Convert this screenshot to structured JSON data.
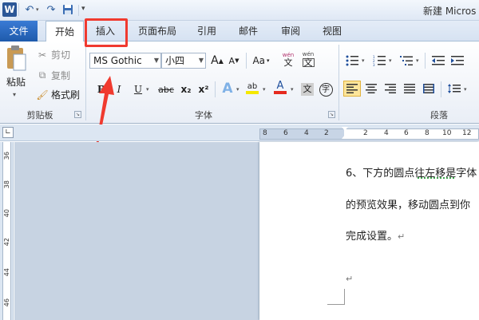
{
  "window": {
    "title": "新建 Micros"
  },
  "tabs": [
    "文件",
    "开始",
    "插入",
    "页面布局",
    "引用",
    "邮件",
    "审阅",
    "视图"
  ],
  "clipboard": {
    "paste": "粘贴",
    "cut": "剪切",
    "copy": "复制",
    "format_painter": "格式刷",
    "group_label": "剪贴板"
  },
  "font": {
    "name": "MS Gothic",
    "size": "小四",
    "group_label": "字体",
    "grow": "A",
    "shrink": "A",
    "change_case": "Aa",
    "wen": "wén",
    "wen2": "文",
    "bold": "B",
    "italic": "I",
    "underline": "U",
    "strike": "abc",
    "subscript": "x₂",
    "superscript": "x²",
    "text_effect": "A",
    "highlight": "ab",
    "font_color": "A",
    "enclose": "字"
  },
  "paragraph": {
    "group_label": "段落"
  },
  "ruler": {
    "numbers": [
      "8",
      "6",
      "4",
      "2",
      "",
      "2",
      "4",
      "6",
      "8",
      "10",
      "12"
    ],
    "vnumbers": [
      "36",
      "38",
      "40",
      "42",
      "44",
      "46"
    ]
  },
  "document": {
    "lines": [
      "6、下方的圆点往左移是字体",
      "的预览效果，移动圆点到你",
      "完成设置。"
    ],
    "para_mark": "↵"
  },
  "colors": {
    "annotation_red": "#f03a2f",
    "file_tab": "#2b66bf",
    "highlight": "#f5e800",
    "font_color": "#e52a1f"
  }
}
